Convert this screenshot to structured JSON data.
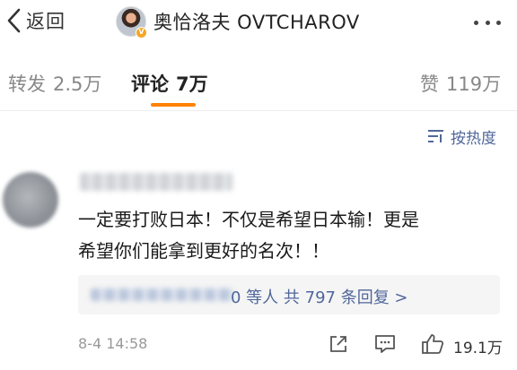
{
  "header": {
    "back_label": "返回",
    "username": "奥恰洛夫 OVTCHAROV",
    "verified_badge": "V"
  },
  "tabs": [
    {
      "label": "转发",
      "count": "2.5万",
      "active": false
    },
    {
      "label": "评论",
      "count": "7万",
      "active": true
    },
    {
      "label": "赞",
      "count": "119万",
      "active": false
    }
  ],
  "sort": {
    "label": "按热度"
  },
  "comment": {
    "text_line1": "一定要打败日本！不仅是希望日本输！更是",
    "text_line2": "希望你们能拿到更好的名次！！",
    "replies_text": "0 等人  共 797 条回复 >",
    "time": "8-4 14:58",
    "like_count": "19.1万"
  },
  "colors": {
    "accent": "#ff8200",
    "link": "#50679a",
    "muted": "#999999"
  },
  "icons": [
    "chevron-left-icon",
    "more-icon",
    "sort-icon",
    "share-icon",
    "comment-icon",
    "like-icon"
  ]
}
